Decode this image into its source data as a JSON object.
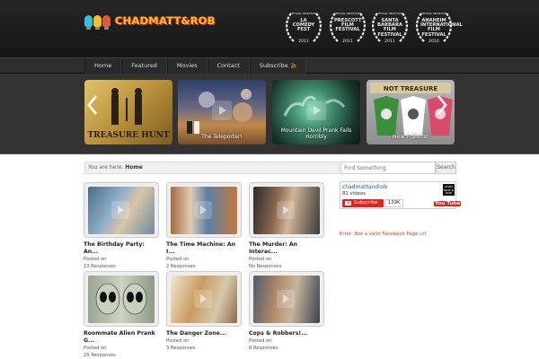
{
  "logo": {
    "text": "CHADMATT&ROB"
  },
  "laurels": [
    {
      "selection": "OFFICIAL SELECTION",
      "name": "LA COMEDY FEST",
      "year": "2011"
    },
    {
      "selection": "OFFICIAL SELECTION",
      "name": "PRESCOTT FILM FESTIVAL",
      "year": "2011"
    },
    {
      "selection": "OFFICIAL SELECTION",
      "name": "SANTA BARBARA FILM FESTIVAL",
      "year": "2011"
    },
    {
      "selection": "OFFICIAL SELECTION",
      "name": "ANAHEIM INTERNATIONAL FILM FESTIVAL",
      "year": "2010"
    }
  ],
  "nav": {
    "items": [
      {
        "label": "Home"
      },
      {
        "label": "Featured"
      },
      {
        "label": "Movies"
      },
      {
        "label": "Contact"
      },
      {
        "label": "Subscribe"
      }
    ]
  },
  "featured": {
    "slides": [
      {
        "caption": ""
      },
      {
        "caption": "The Teleporter!"
      },
      {
        "caption": "Mountain Devil Prank Fails Horribly"
      },
      {
        "caption": "New T-Shirts!"
      }
    ],
    "slide1_art_text": "TREASURE HUNT",
    "slide4_art_text": "NOT TREASURE"
  },
  "breadcrumb": {
    "prefix": "You are here:",
    "current": "Home"
  },
  "search": {
    "placeholder": "Find Something",
    "button": "Search"
  },
  "posts": [
    {
      "title": "The Birthday Party: An...",
      "posted": "Posted on",
      "responses": "10 Responses"
    },
    {
      "title": "The Time Machine: An I...",
      "posted": "Posted on",
      "responses": "2 Responses"
    },
    {
      "title": "The Murder: An Interac...",
      "posted": "Posted on",
      "responses": "No Responses"
    },
    {
      "title": "Roommate Alien Prank G...",
      "posted": "Posted on",
      "responses": "25 Responses"
    },
    {
      "title": "The Danger Zone...",
      "posted": "Posted on",
      "responses": "3 Responses"
    },
    {
      "title": "Cops & Robbers!...",
      "posted": "Posted on",
      "responses": "8 Responses"
    }
  ],
  "youtube": {
    "channel": "chadmattandrob",
    "videos": "81 videos",
    "subscribe": "Subscribe",
    "subscribers": "139K",
    "logo_you": "You",
    "logo_tube": "Tube",
    "avatar_text": "CHAD MATT & ROB"
  },
  "facebook": {
    "error": "Error: Not a valid Facebook Page url."
  },
  "colors": {
    "header_bg": "#1e1e1e",
    "nav_bg": "#2d2d2d",
    "logo_orange": "#ffb42a",
    "yt_red": "#e62117",
    "error": "#c6441e"
  }
}
